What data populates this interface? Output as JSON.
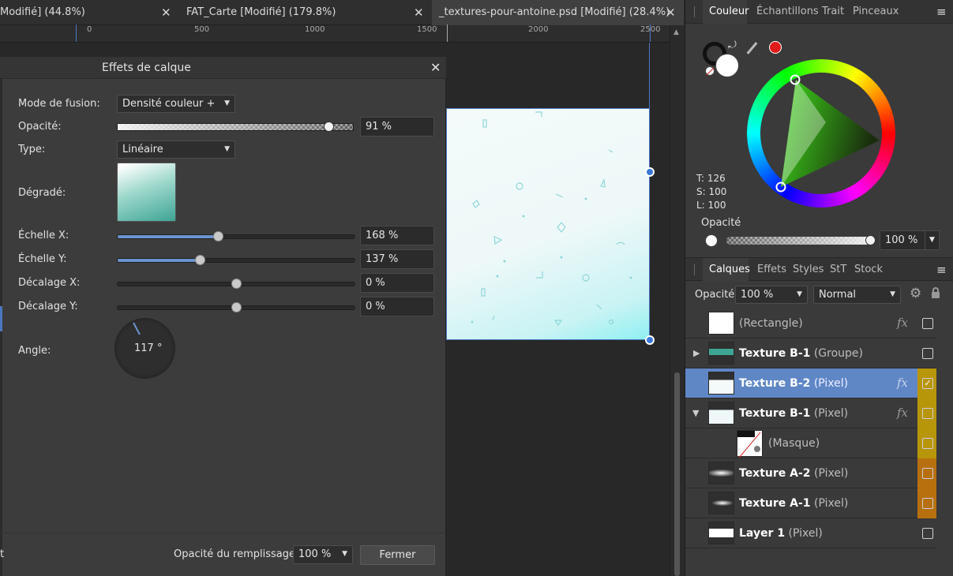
{
  "tabs": [
    {
      "label": "Modifié] (44.8%)",
      "close": "✕"
    },
    {
      "label": "FAT_Carte [Modifié] (179.8%)",
      "close": "✕"
    },
    {
      "label": "_textures-pour-antoine.psd [Modifié] (28.4%)",
      "close": "✕"
    }
  ],
  "ruler": {
    "labels": [
      "0",
      "500",
      "1000",
      "1500",
      "2000",
      "2500"
    ]
  },
  "dialog": {
    "title": "Effets de calque",
    "close": "✕",
    "blend_label": "Mode de fusion:",
    "blend_value": "Densité couleur +",
    "opacity_label": "Opacité:",
    "opacity_value": "91 %",
    "opacity_level": 0.91,
    "type_label": "Type:",
    "type_value": "Linéaire",
    "gradient_label": "Dégradé:",
    "scalex_label": "Échelle X:",
    "scalex_value": "168 %",
    "scaley_label": "Échelle Y:",
    "scaley_value": "137 %",
    "offx_label": "Décalage X:",
    "offx_value": "0 %",
    "offy_label": "Décalage Y:",
    "offy_value": "0 %",
    "angle_label": "Angle:",
    "angle_value": "117 °",
    "left_text": "t",
    "fill_opacity_label": "Opacité du remplissage:",
    "fill_opacity_value": "100 %",
    "close_button": "Fermer"
  },
  "color_panel": {
    "tabs": [
      "Couleur",
      "Échantillons",
      "Trait",
      "Pinceaux"
    ],
    "menu_icon": "≡",
    "t_value": "T: 126",
    "s_value": "S: 100",
    "l_value": "L: 100",
    "opacity_label": "Opacité",
    "opacity_value": "100 %"
  },
  "layers_panel": {
    "tabs": [
      "Calques",
      "Effets",
      "Styles",
      "StT",
      "Stock"
    ],
    "menu_icon": "≡",
    "opacity_label": "Opacité:",
    "opacity_value": "100 %",
    "blend_value": "Normal",
    "rows": [
      {
        "name": "",
        "type": "(Rectangle)",
        "fx": "fx",
        "checked": false
      },
      {
        "name": "Texture B-1",
        "type": " (Groupe)",
        "fx": "",
        "checked": false
      },
      {
        "name": "Texture B-2",
        "type": " (Pixel)",
        "fx": "fx",
        "checked": true
      },
      {
        "name": "Texture B-1",
        "type": " (Pixel)",
        "fx": "fx",
        "checked": false
      },
      {
        "name": "",
        "type": "(Masque)",
        "fx": "",
        "checked": false
      },
      {
        "name": "Texture A-2",
        "type": " (Pixel)",
        "fx": "",
        "checked": false
      },
      {
        "name": "Texture A-1",
        "type": " (Pixel)",
        "fx": "",
        "checked": false
      },
      {
        "name": "Layer 1",
        "type": " (Pixel)",
        "fx": "",
        "checked": false
      }
    ]
  },
  "colors": {
    "accent": "#6b93cf",
    "selected_row": "#5f87c6",
    "tag_yellow": "#b8960a",
    "tag_orange": "#b8700e",
    "red_swatch": "#e01b1b"
  }
}
